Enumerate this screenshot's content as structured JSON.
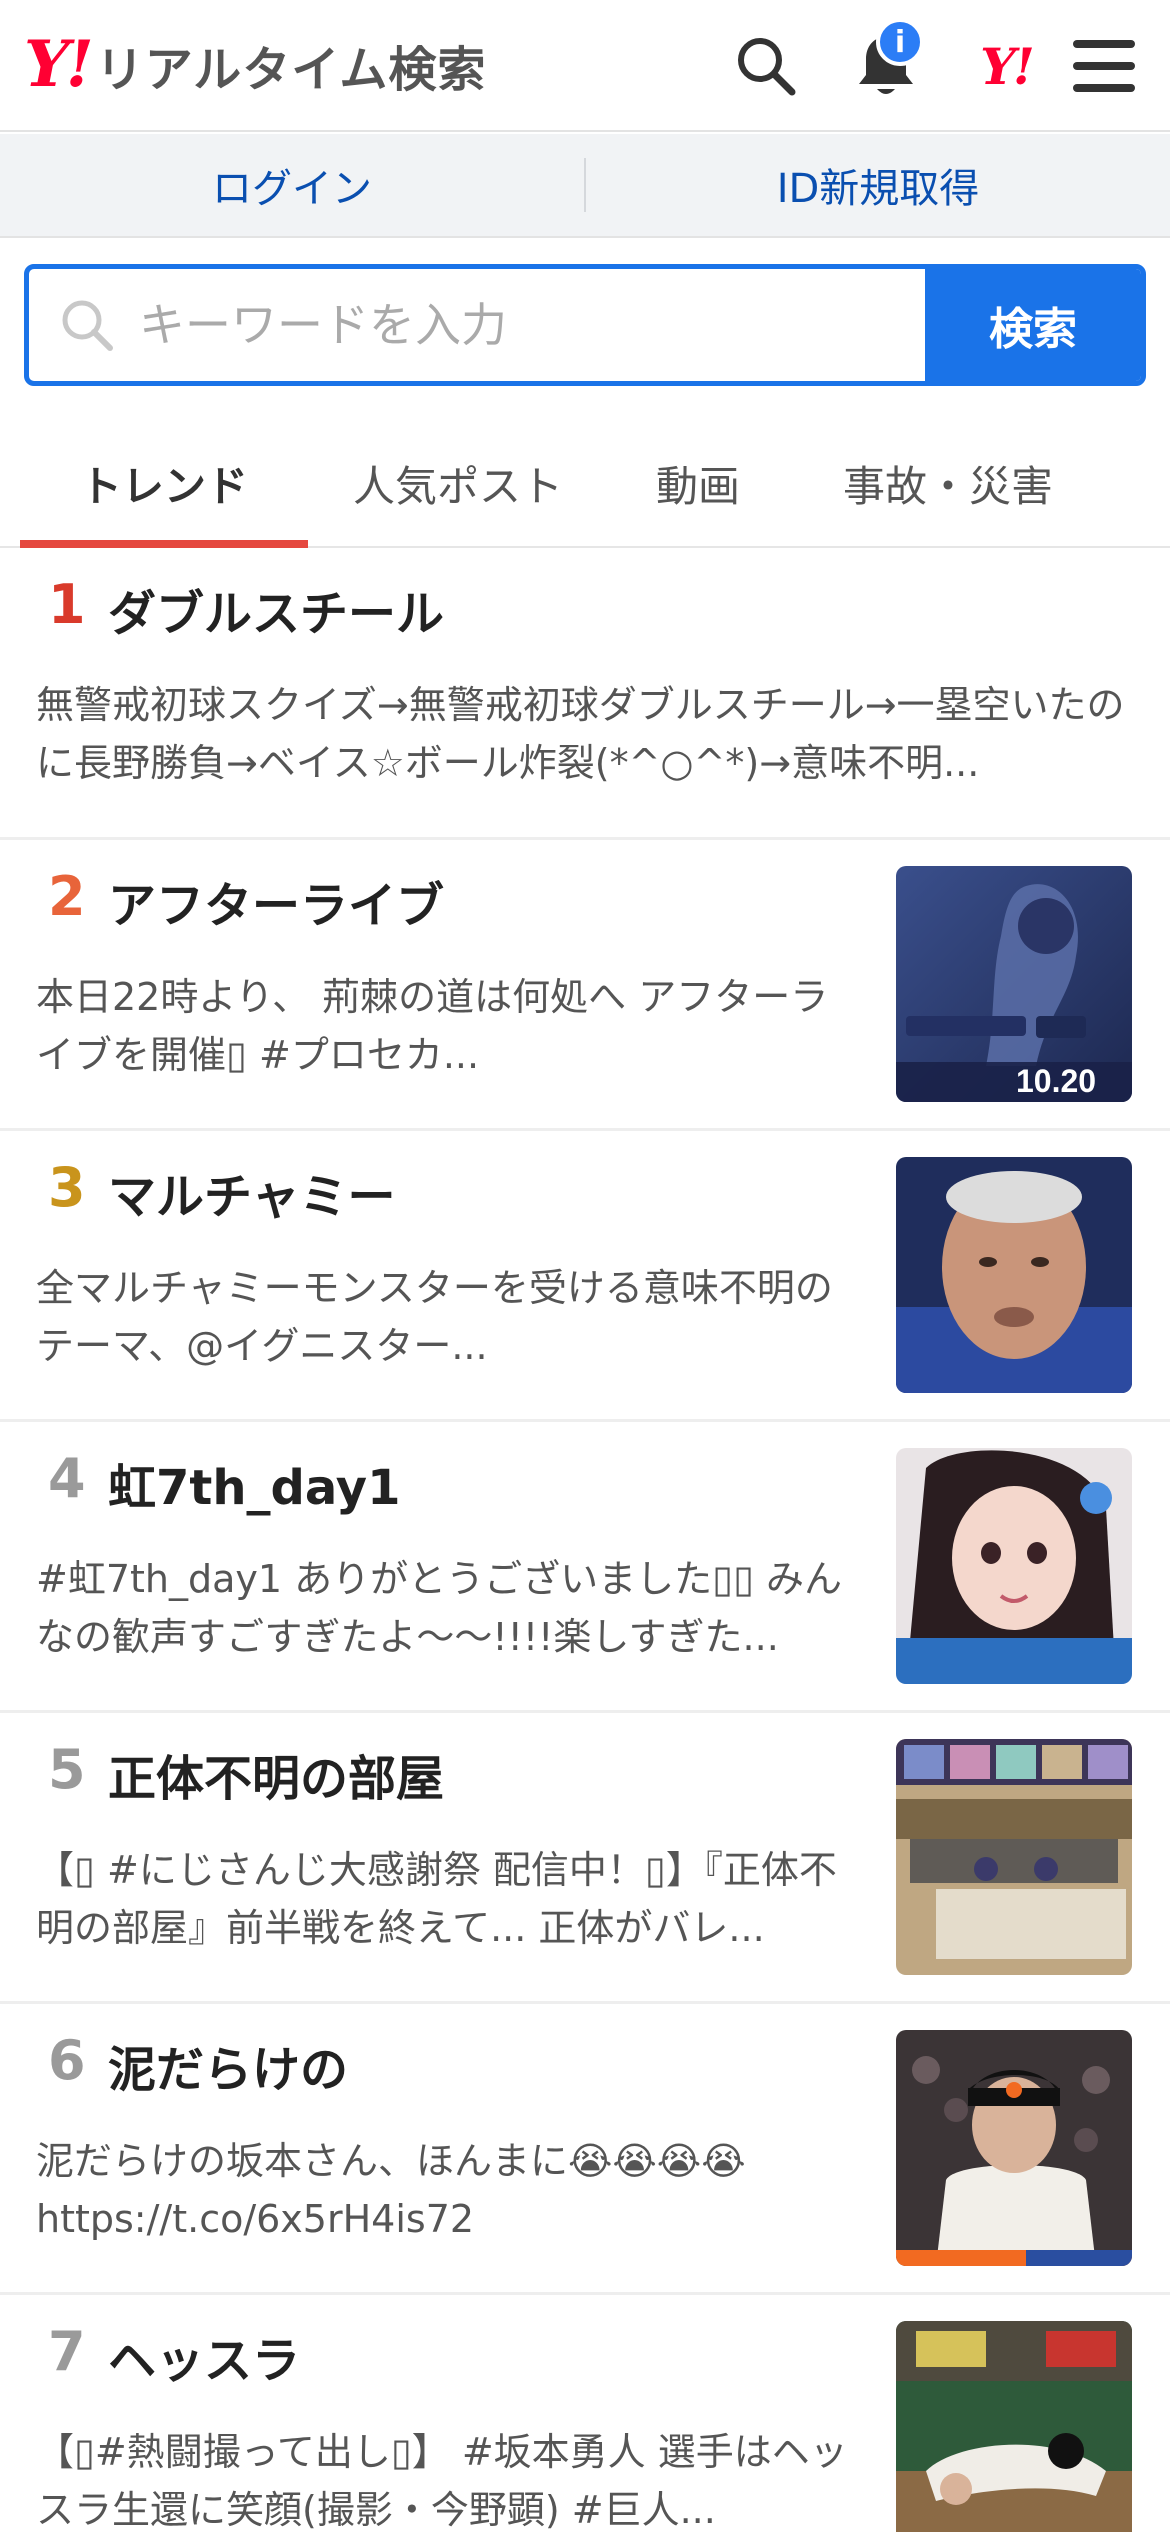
{
  "header": {
    "logo_mark": "Y!",
    "app_title": "リアルタイム検索",
    "notification_badge": "i",
    "yahoo_mark": "Y!"
  },
  "account": {
    "login_label": "ログイン",
    "signup_label": "ID新規取得"
  },
  "search": {
    "placeholder": "キーワードを入力",
    "button_label": "検索"
  },
  "tabs": [
    {
      "label": "トレンド",
      "active": true
    },
    {
      "label": "人気ポスト",
      "active": false
    },
    {
      "label": "動画",
      "active": false
    },
    {
      "label": "事故・災害",
      "active": false
    }
  ],
  "colors": {
    "brand_red": "#ff0033",
    "accent_blue": "#1a73e8",
    "link_blue": "#0a4fb0",
    "active_tab_underline": "#e5483f",
    "rank1": "#d93a2b",
    "rank2": "#e8643a",
    "rank3": "#c9941c",
    "rank_other": "#9a9a9a"
  },
  "trends": [
    {
      "rank": "1",
      "title": "ダブルスチール",
      "description": "無警戒初球スクイズ→無警戒初球ダブルスチール→一塁空いたのに長野勝負→ベイス☆ボール炸裂(*^○^*)→意味不明...",
      "thumb": "none"
    },
    {
      "rank": "2",
      "title": "アフターライブ",
      "description": "本日22時より、 荊棘の道は何処へ アフターライブを開催▯ #プロセカ...",
      "thumb": "anime-event-banner",
      "thumb_date": "10.20"
    },
    {
      "rank": "3",
      "title": "マルチャミー",
      "description": "全マルチャミーモンスターを受ける意味不明のテーマ、@イグニスター...",
      "thumb": "man-portrait"
    },
    {
      "rank": "4",
      "title": "虹7th_day1",
      "description": "#虹7th_day1 ありがとうございました▯▯ みんなの歓声すごすぎたよ〜〜!!!!楽しすぎた...",
      "thumb": "idol-selfie"
    },
    {
      "rank": "5",
      "title": "正体不明の部屋",
      "description": "【▯ #にじさんじ大感謝祭 配信中！▯】『正体不明の部屋』前半戦を終えて... 正体がバレ...",
      "thumb": "game-show-stage"
    },
    {
      "rank": "6",
      "title": "泥だらけの",
      "description": "泥だらけの坂本さん、ほんまに😭😭😭😭 https://t.co/6x5rH4is72",
      "thumb": "baseball-player"
    },
    {
      "rank": "7",
      "title": "ヘッスラ",
      "description": "【▯#熱闘撮って出し▯】 #坂本勇人 選手はヘッスラ生還に笑顔(撮影・今野顕) #巨人...",
      "thumb": "baseball-slide"
    }
  ]
}
